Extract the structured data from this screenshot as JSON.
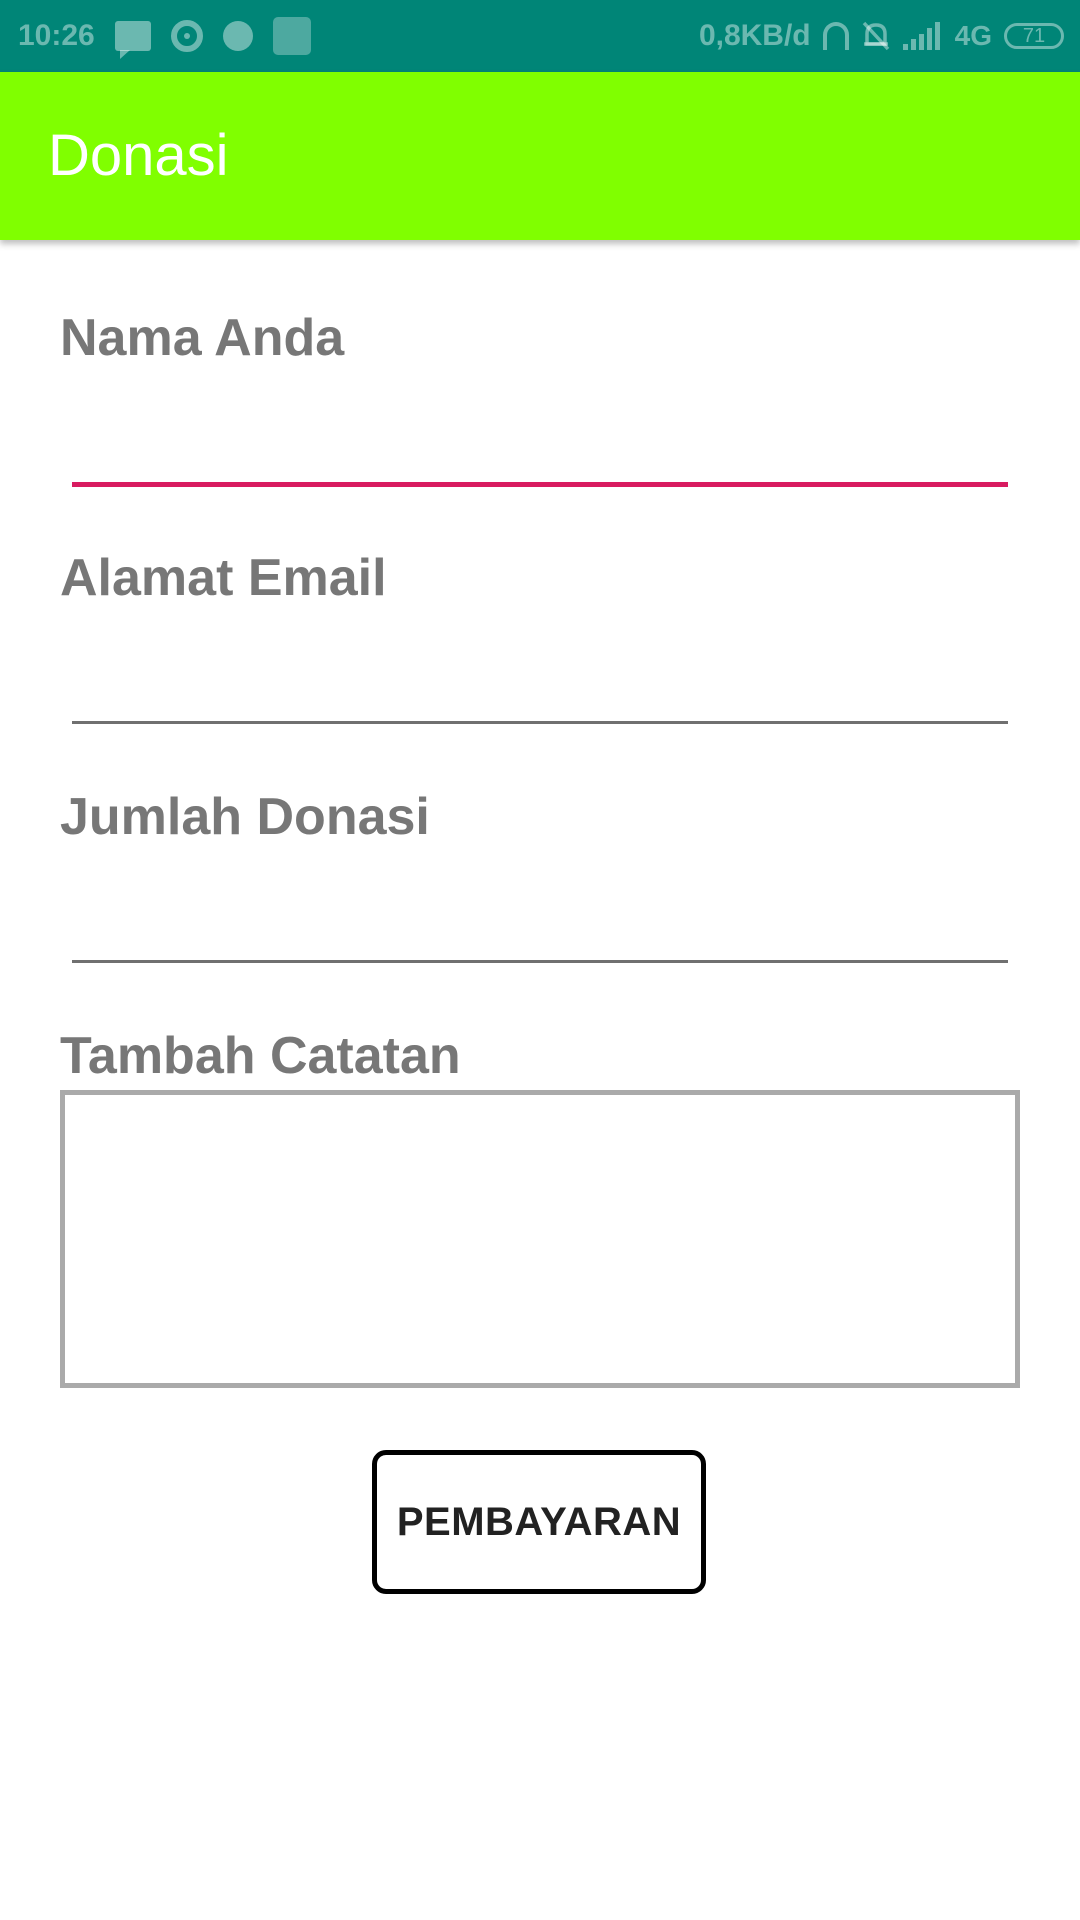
{
  "status_bar": {
    "time": "10:26",
    "net_speed": "0,8KB/d",
    "network_type": "4G",
    "battery": "71",
    "left_icons": [
      "message-icon",
      "chrome-icon",
      "dot-icon",
      "app-square-icon"
    ],
    "right_icons": [
      "headset-icon",
      "bell-off-icon",
      "signal-icon",
      "battery-icon"
    ],
    "background_color": "#008577"
  },
  "app_bar": {
    "title": "Donasi",
    "background_color": "#80ff00"
  },
  "form": {
    "name_label": "Nama Anda",
    "name_value": "",
    "email_label": "Alamat Email",
    "email_value": "",
    "amount_label": "Jumlah Donasi",
    "amount_value": "",
    "notes_label": "Tambah Catatan",
    "notes_value": "",
    "focused_underline_color": "#d81b60"
  },
  "actions": {
    "pay_label": "PEMBAYARAN"
  }
}
